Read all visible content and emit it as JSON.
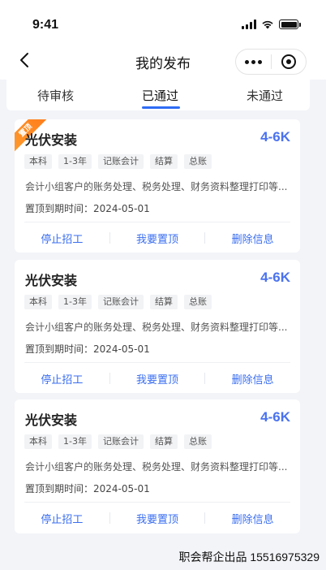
{
  "status": {
    "time": "9:41"
  },
  "nav": {
    "title": "我的发布"
  },
  "tabs": [
    {
      "label": "待审核"
    },
    {
      "label": "已通过",
      "active": true
    },
    {
      "label": "未通过"
    }
  ],
  "jobs": [
    {
      "pinned_badge": "置顶",
      "title": "光伏安装",
      "salary": "4-6K",
      "tags": [
        "本科",
        "1-3年",
        "记账会计",
        "结算",
        "总账"
      ],
      "description": "会计小组客户的账务处理、税务处理、财务资料整理打印等...",
      "expire": "置顶到期时间：2024-05-01",
      "actions": [
        "停止招工",
        "我要置顶",
        "删除信息"
      ]
    },
    {
      "title": "光伏安装",
      "salary": "4-6K",
      "tags": [
        "本科",
        "1-3年",
        "记账会计",
        "结算",
        "总账"
      ],
      "description": "会计小组客户的账务处理、税务处理、财务资料整理打印等...",
      "expire": "置顶到期时间：2024-05-01",
      "actions": [
        "停止招工",
        "我要置顶",
        "删除信息"
      ]
    },
    {
      "title": "光伏安装",
      "salary": "4-6K",
      "tags": [
        "本科",
        "1-3年",
        "记账会计",
        "结算",
        "总账"
      ],
      "description": "会计小组客户的账务处理、税务处理、财务资料整理打印等...",
      "expire": "置顶到期时间：2024-05-01",
      "actions": [
        "停止招工",
        "我要置顶",
        "删除信息"
      ]
    }
  ],
  "footer": {
    "watermark": "职会帮企出品 15516975329"
  },
  "colors": {
    "accent": "#2f6cf6",
    "salary": "#4a72f0",
    "badge": "#ff8a24",
    "background": "#f3f4f8"
  }
}
